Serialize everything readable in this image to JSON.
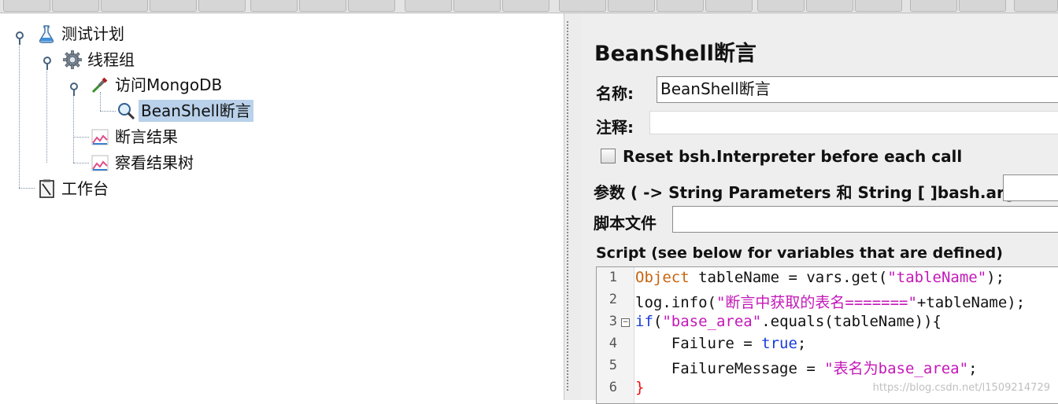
{
  "tree": {
    "nodes": [
      {
        "label": "测试计划",
        "icon": "flask-icon"
      },
      {
        "label": "线程组",
        "icon": "gear-icon"
      },
      {
        "label": "访问MongoDB",
        "icon": "dropper-icon"
      },
      {
        "label": "BeanShell断言",
        "icon": "magnifier-icon",
        "selected": true
      },
      {
        "label": "断言结果",
        "icon": "chart-icon"
      },
      {
        "label": "察看结果树",
        "icon": "chart-icon"
      },
      {
        "label": "工作台",
        "icon": "clipboard-icon"
      }
    ]
  },
  "panel": {
    "title": "BeanShell断言",
    "name_label": "名称:",
    "name_value": "BeanShell断言",
    "comment_label": "注释:",
    "comment_value": "",
    "reset_label": "Reset bsh.Interpreter before each call",
    "reset_checked": false,
    "params_label": "参数 ( -> String Parameters 和 String [ ]bash.args)",
    "params_value": "",
    "file_label": "脚本文件",
    "file_value": "",
    "script_label": "Script (see below for variables that are defined)"
  },
  "script": {
    "line_numbers": [
      "1",
      "2",
      "3",
      "4",
      "5",
      "6"
    ],
    "l1": {
      "type": "Object",
      "rest": " tableName = vars.get(",
      "str": "\"tableName\"",
      "end": ");"
    },
    "l2": {
      "a": "log.info(",
      "str": "\"断言中获取的表名=======\"",
      "end": "+tableName);"
    },
    "l3": {
      "kw": "if",
      "a": "(",
      "str": "\"base_area\"",
      "end": ".equals(tableName)){"
    },
    "l4": {
      "a": "    Failure = ",
      "kw": "true",
      "end": ";"
    },
    "l5": {
      "a": "    FailureMessage = ",
      "str": "\"表名为base_area\"",
      "end": ";"
    },
    "l6": {
      "brace": "}"
    }
  },
  "watermark": "https://blog.csdn.net/l1509214729",
  "colors": {
    "selection": "#b9d1ea",
    "type_kw": "#c7640f",
    "keyword": "#1a3cd8",
    "string": "#c418b8"
  }
}
